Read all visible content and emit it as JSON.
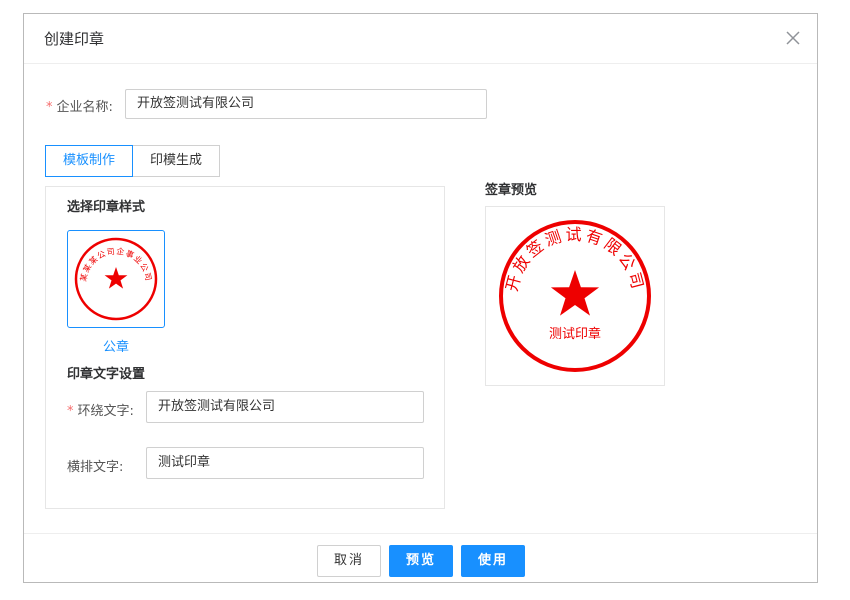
{
  "dialog": {
    "title": "创建印章",
    "close_icon": "close-icon"
  },
  "company": {
    "label": "企业名称:",
    "value": "开放签测试有限公司"
  },
  "tabs": [
    {
      "label": "模板制作",
      "active": true
    },
    {
      "label": "印模生成",
      "active": false
    }
  ],
  "template": {
    "section_title": "选择印章样式",
    "styles": [
      {
        "name": "公章",
        "sample_ring_text": "某某某公司企事业公司",
        "selected": true
      }
    ]
  },
  "seal_text": {
    "section_title": "印章文字设置",
    "ring_label": "环绕文字:",
    "ring_value": "开放签测试有限公司",
    "horizontal_label": "横排文字:",
    "horizontal_value": "测试印章"
  },
  "preview": {
    "title": "签章预览",
    "ring_text": "开放签测试有限公司",
    "center_text": "测试印章",
    "seal_color": "#ee0000"
  },
  "footer": {
    "cancel": "取消",
    "preview": "预览",
    "use": "使用"
  },
  "colors": {
    "accent": "#1890ff",
    "required": "#f56c6c",
    "seal": "#ee0000"
  }
}
